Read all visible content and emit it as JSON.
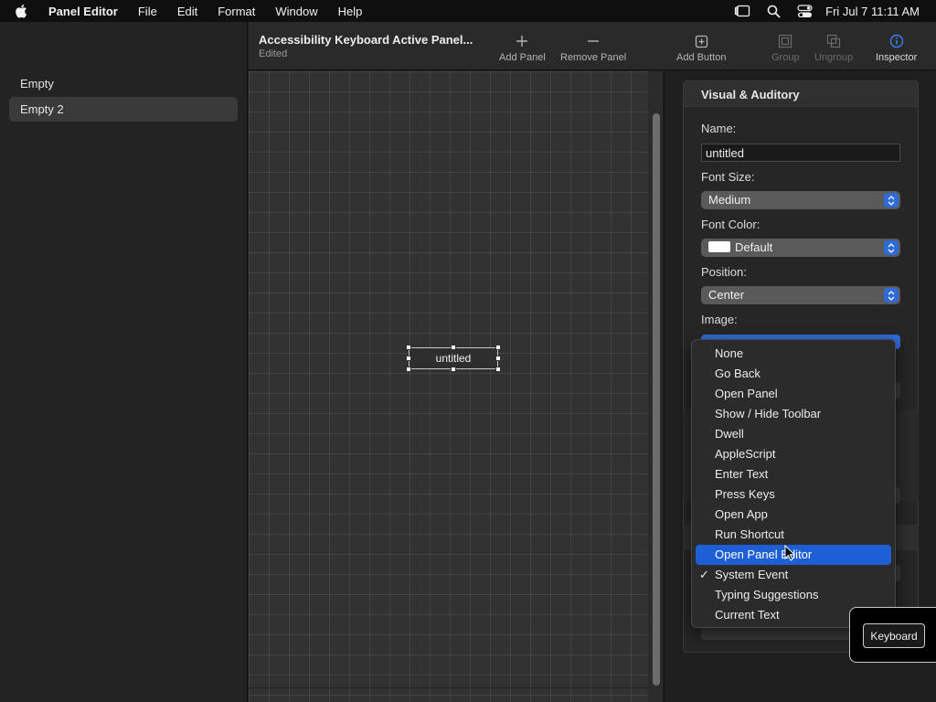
{
  "menubar": {
    "app_name": "Panel Editor",
    "items": [
      "File",
      "Edit",
      "Format",
      "Window",
      "Help"
    ],
    "clock": "Fri Jul 7  11:11 AM"
  },
  "sidebar": {
    "items": [
      {
        "label": "Empty",
        "selected": false
      },
      {
        "label": "Empty 2",
        "selected": true
      }
    ]
  },
  "toolbar": {
    "title": "Accessibility Keyboard Active Panel...",
    "subtitle": "Edited",
    "add_panel": "Add Panel",
    "remove_panel": "Remove Panel",
    "add_button": "Add Button",
    "group": "Group",
    "ungroup": "Ungroup",
    "inspector": "Inspector"
  },
  "canvas": {
    "button_label": "untitled"
  },
  "inspector": {
    "header": "Visual & Auditory",
    "name_label": "Name:",
    "name_value": "untitled",
    "font_size_label": "Font Size:",
    "font_size_value": "Medium",
    "font_color_label": "Font Color:",
    "font_color_value": "Default",
    "position_label": "Position:",
    "position_value": "Center",
    "image_label": "Image:"
  },
  "action_menu": {
    "items": [
      {
        "label": "None",
        "checked": false,
        "highlighted": false
      },
      {
        "label": "Go Back",
        "checked": false,
        "highlighted": false
      },
      {
        "label": "Open Panel",
        "checked": false,
        "highlighted": false
      },
      {
        "label": "Show / Hide Toolbar",
        "checked": false,
        "highlighted": false
      },
      {
        "label": "Dwell",
        "checked": false,
        "highlighted": false
      },
      {
        "label": "AppleScript",
        "checked": false,
        "highlighted": false
      },
      {
        "label": "Enter Text",
        "checked": false,
        "highlighted": false
      },
      {
        "label": "Press Keys",
        "checked": false,
        "highlighted": false
      },
      {
        "label": "Open App",
        "checked": false,
        "highlighted": false
      },
      {
        "label": "Run Shortcut",
        "checked": false,
        "highlighted": false
      },
      {
        "label": "Open Panel Editor",
        "checked": false,
        "highlighted": true
      },
      {
        "label": "System Event",
        "checked": true,
        "highlighted": false
      },
      {
        "label": "Typing Suggestions",
        "checked": false,
        "highlighted": false
      },
      {
        "label": "Current Text",
        "checked": false,
        "highlighted": false
      }
    ]
  },
  "keyboard_window": {
    "button_label": "Keyboard"
  },
  "colors": {
    "accent": "#1f5fd6",
    "popup_arrow": "#2f6bd8"
  }
}
